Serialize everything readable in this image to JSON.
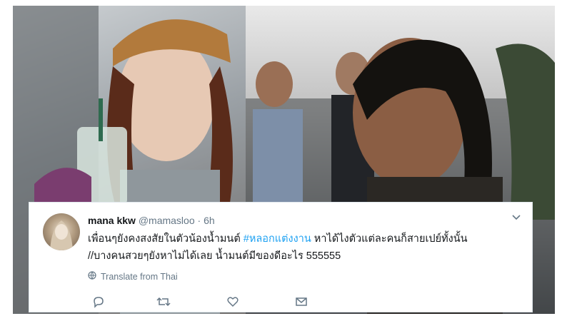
{
  "tweet": {
    "display_name": "mana kkw",
    "handle": "@mamasloo",
    "separator": "·",
    "time": "6h",
    "text_line1_before": "เพื่อนๆยังคงสงสัยในตัวน้องน้ำมนต์ ",
    "hashtag": "#หลอกแต่งงาน",
    "text_line1_after": " หาได้ไงตัวแต่ละคนก็สายเปย์ทั้งนั้น",
    "text_line2": "//บางคนสวยๆยังหาไม่ได้เลย น้ำมนต์มีของดีอะไร 555555",
    "translate_label": "Translate from Thai"
  },
  "colors": {
    "link": "#1da1f2",
    "muted": "#657786",
    "text": "#14171a",
    "border": "#e1e8ed"
  },
  "icons": {
    "avatar": "avatar-image",
    "chevron": "chevron-down-icon",
    "globe": "globe-icon",
    "reply": "reply-icon",
    "retweet": "retweet-icon",
    "like": "heart-icon",
    "dm": "envelope-icon"
  }
}
